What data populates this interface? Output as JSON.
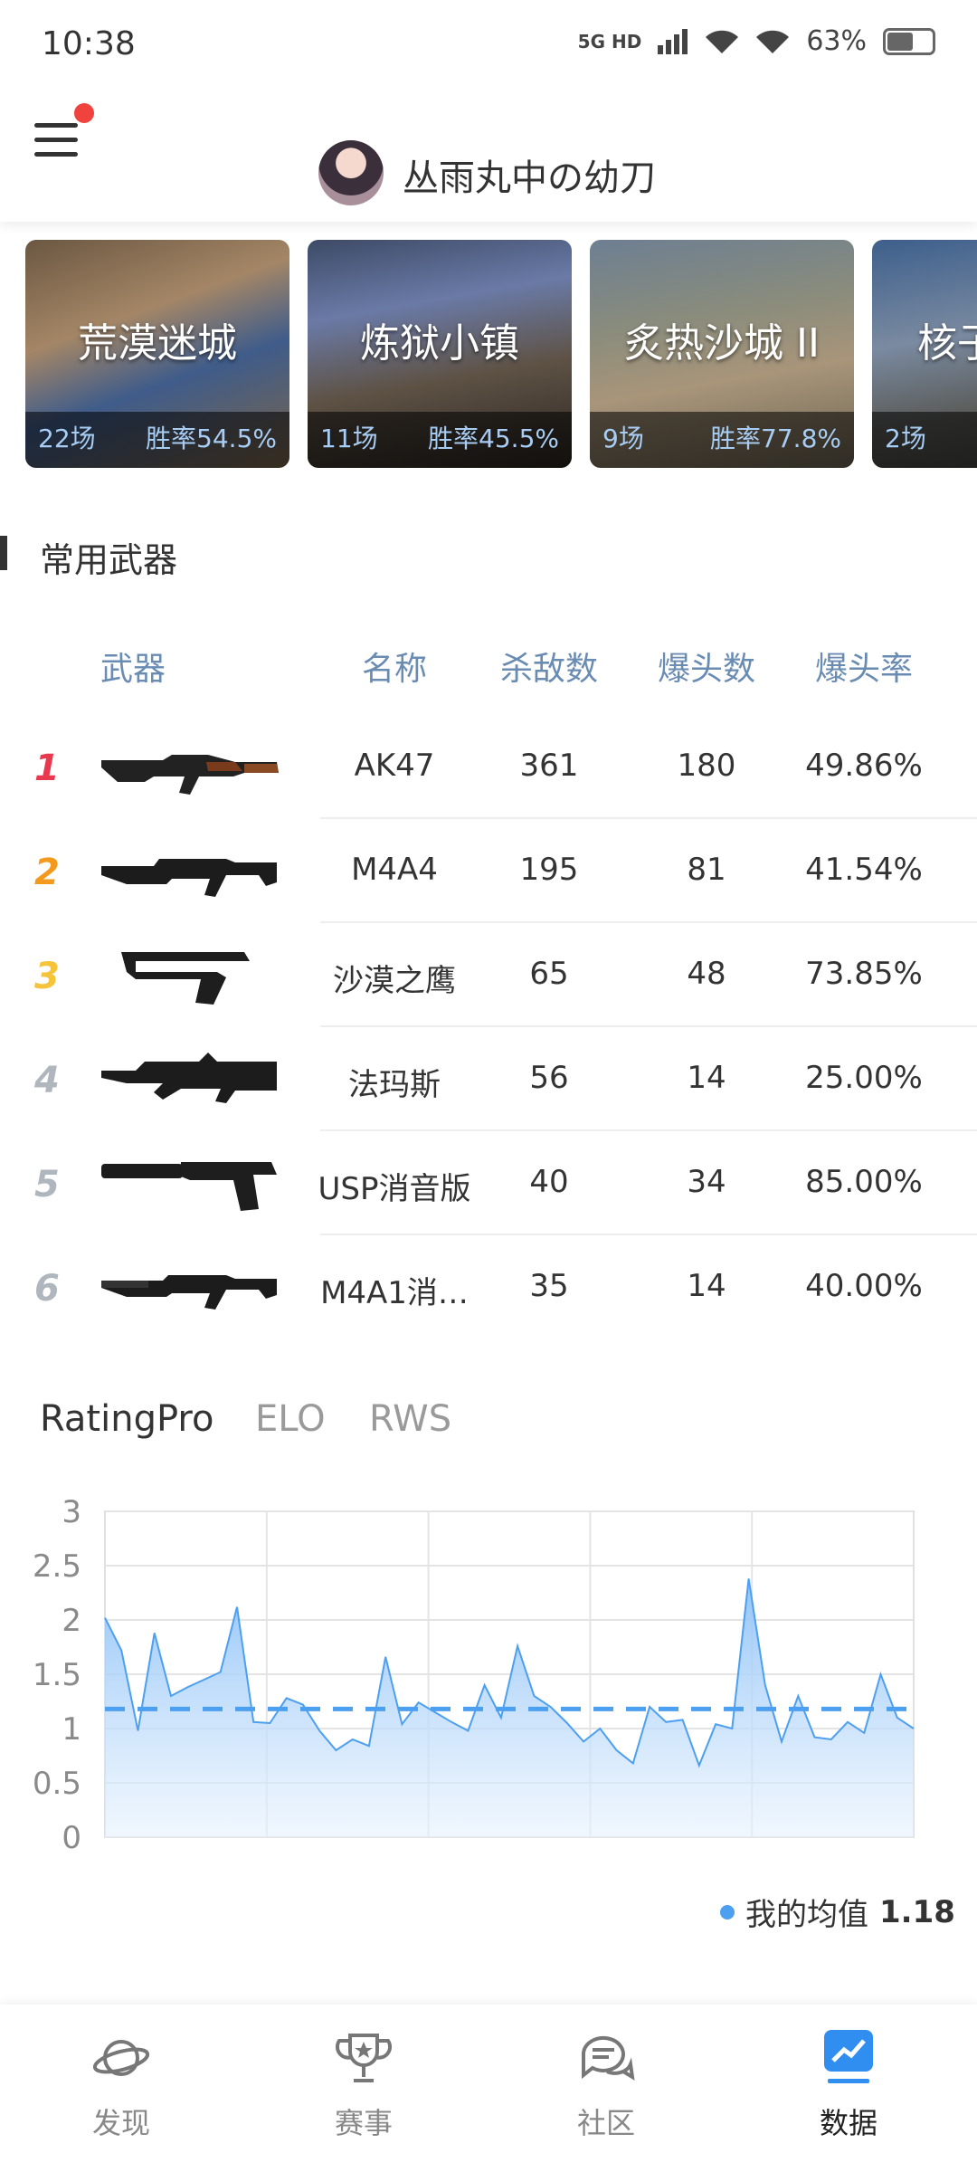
{
  "status_bar": {
    "time": "10:38",
    "network": "5G HD",
    "battery_percent": "63%",
    "battery_level": 0.63
  },
  "header": {
    "username": "丛雨丸中の幼刀",
    "has_notification_dot": true
  },
  "maps": [
    {
      "name": "荒漠迷城",
      "games": "22场",
      "win_rate": "胜率54.5%"
    },
    {
      "name": "炼狱小镇",
      "games": "11场",
      "win_rate": "胜率45.5%"
    },
    {
      "name": "炙热沙城 II",
      "games": "9场",
      "win_rate": "胜率77.8%"
    },
    {
      "name": "核子危机",
      "games": "2场",
      "win_rate": ""
    }
  ],
  "weapons_section": {
    "title": "常用武器",
    "columns": [
      "武器",
      "名称",
      "杀敌数",
      "爆头数",
      "爆头率"
    ],
    "rows": [
      {
        "rank": "1",
        "name": "AK47",
        "kills": "361",
        "headshots": "180",
        "hs_rate": "49.86%",
        "rank_color": "#e8394f"
      },
      {
        "rank": "2",
        "name": "M4A4",
        "kills": "195",
        "headshots": "81",
        "hs_rate": "41.54%",
        "rank_color": "#f39a1e"
      },
      {
        "rank": "3",
        "name": "沙漠之鹰",
        "kills": "65",
        "headshots": "48",
        "hs_rate": "73.85%",
        "rank_color": "#f5c43a"
      },
      {
        "rank": "4",
        "name": "法玛斯",
        "kills": "56",
        "headshots": "14",
        "hs_rate": "25.00%",
        "rank_color": "#b0b6bd"
      },
      {
        "rank": "5",
        "name": "USP消音版",
        "kills": "40",
        "headshots": "34",
        "hs_rate": "85.00%",
        "rank_color": "#b0b6bd"
      },
      {
        "rank": "6",
        "name": "M4A1消…",
        "kills": "35",
        "headshots": "14",
        "hs_rate": "40.00%",
        "rank_color": "#b0b6bd"
      }
    ]
  },
  "rating_tabs": [
    {
      "label": "RatingPro",
      "active": true
    },
    {
      "label": "ELO",
      "active": false
    },
    {
      "label": "RWS",
      "active": false
    }
  ],
  "chart_data": {
    "type": "area",
    "y_ticks": [
      "3",
      "2.5",
      "2",
      "1.5",
      "1",
      "0.5",
      "0"
    ],
    "ylim": [
      0,
      3
    ],
    "grid": true,
    "values": [
      2.02,
      1.72,
      0.98,
      1.88,
      1.3,
      1.38,
      1.45,
      1.52,
      2.12,
      1.06,
      1.05,
      1.28,
      1.22,
      0.98,
      0.8,
      0.9,
      0.84,
      1.66,
      1.04,
      1.24,
      1.15,
      1.06,
      0.98,
      1.4,
      1.1,
      1.76,
      1.3,
      1.2,
      1.05,
      0.88,
      1.0,
      0.8,
      0.68,
      1.2,
      1.06,
      1.08,
      0.66,
      1.04,
      1.0,
      2.38,
      1.4,
      0.88,
      1.3,
      0.92,
      0.9,
      1.06,
      0.96,
      1.5,
      1.1,
      1.0
    ],
    "average": 1.18,
    "average_line_value": 1.18,
    "legend_label": "我的均值",
    "legend_value": "1.18",
    "line_color": "#4d9ff0"
  },
  "bottom_nav": [
    {
      "label": "发现",
      "icon": "planet-icon",
      "active": false
    },
    {
      "label": "赛事",
      "icon": "trophy-icon",
      "active": false
    },
    {
      "label": "社区",
      "icon": "chat-icon",
      "active": false
    },
    {
      "label": "数据",
      "icon": "chart-icon",
      "active": true
    }
  ]
}
